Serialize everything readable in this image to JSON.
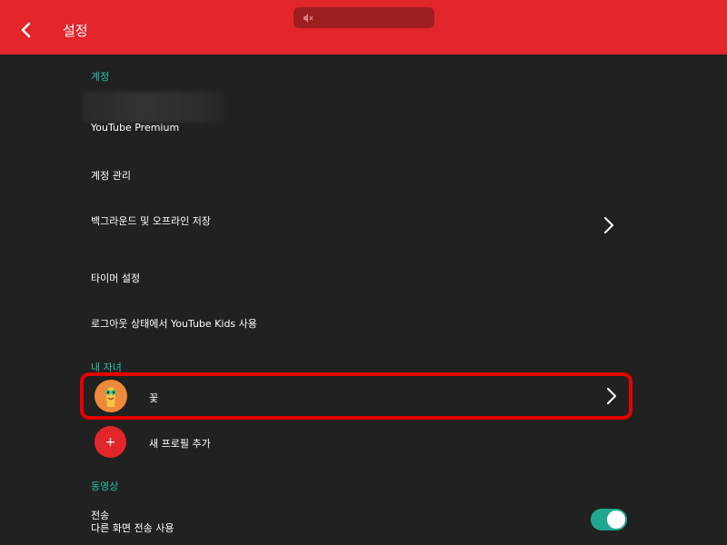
{
  "header": {
    "title": "설정",
    "back_icon": "chevron-left-icon",
    "mute_icon": "speaker-muted-icon",
    "background_color": "#e3262b"
  },
  "sections": {
    "account": {
      "label": "계정",
      "premium_label": "YouTube Premium",
      "manage_account": "계정 관리",
      "background_offline": "백그라운드 및 오프라인 저장",
      "timer": "타이머 설정",
      "signed_out_kids": "로그아웃 상태에서 YouTube Kids 사용"
    },
    "my_kids": {
      "label": "내 자녀",
      "child_name": "꽃",
      "add_profile": "새 프로필 추가",
      "add_icon": "+"
    },
    "video": {
      "label": "동영상",
      "cast_title": "전송",
      "cast_subtitle": "다른 화면 전송 사용",
      "cast_enabled": true
    }
  },
  "colors": {
    "accent_teal": "#26c1a6",
    "highlight_red": "#e60000",
    "toggle_on": "#1fa88f",
    "background": "#212121"
  }
}
